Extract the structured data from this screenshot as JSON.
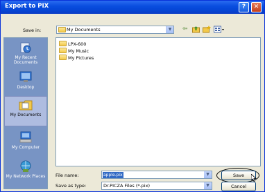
{
  "window": {
    "title": "Export to PIX",
    "help_glyph": "?",
    "close_glyph": "✕"
  },
  "toolbar": {
    "save_in_label": "Save in:",
    "save_in_value": "My Documents",
    "icons": [
      "back-icon",
      "up-folder-icon",
      "new-folder-icon",
      "views-menu-icon"
    ]
  },
  "places": [
    {
      "label": "My Recent Documents",
      "icon": "recent-documents-icon"
    },
    {
      "label": "Desktop",
      "icon": "desktop-icon"
    },
    {
      "label": "My Documents",
      "icon": "my-documents-icon"
    },
    {
      "label": "My Computer",
      "icon": "my-computer-icon"
    },
    {
      "label": "My Network Places",
      "icon": "network-places-icon"
    }
  ],
  "files": [
    {
      "name": "LPX-600",
      "icon": "folder-icon"
    },
    {
      "name": "My Music",
      "icon": "folder-icon"
    },
    {
      "name": "My Pictures",
      "icon": "folder-icon"
    }
  ],
  "form": {
    "file_name_label": "File name:",
    "file_name_value": "apple.pix",
    "save_as_type_label": "Save as type:",
    "save_as_type_value": "Dr.PICZA Files (*.pix)"
  },
  "buttons": {
    "save": "Save",
    "cancel": "Cancel"
  },
  "colors": {
    "title_bar": "#0a4ee0",
    "places_bar": "#7894c4",
    "selection": "#316ac5"
  }
}
